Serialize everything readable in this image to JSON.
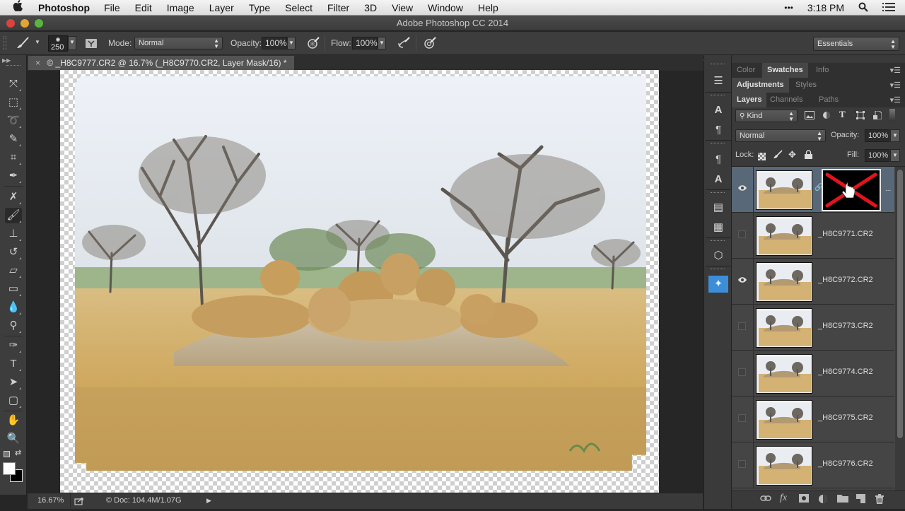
{
  "menubar": {
    "apple": "",
    "app_name": "Photoshop",
    "items": [
      "File",
      "Edit",
      "Image",
      "Layer",
      "Type",
      "Select",
      "Filter",
      "3D",
      "View",
      "Window",
      "Help"
    ],
    "overflow": "•••",
    "clock": "3:18 PM",
    "search_icon": "spotlight-search-icon",
    "list_icon": "notification-center-icon"
  },
  "window": {
    "title": "Adobe Photoshop CC 2014"
  },
  "options_bar": {
    "tool_icon": "brush-tool-icon",
    "brush_size": "250",
    "mode_label": "Mode:",
    "mode_value": "Normal",
    "opacity_label": "Opacity:",
    "opacity_value": "100%",
    "flow_label": "Flow:",
    "flow_value": "100%",
    "workspace": "Essentials"
  },
  "document": {
    "tab_title": "© _H8C9777.CR2 @ 16.7% (_H8C9770.CR2, Layer Mask/16) *",
    "close": "×"
  },
  "status_bar": {
    "zoom": "16.67%",
    "doc_info": "© Doc: 104.4M/1.07G",
    "arrow": "▶"
  },
  "tools": [
    {
      "name": "move-tool",
      "glyph": "⤧"
    },
    {
      "name": "marquee-tool",
      "glyph": "⬚"
    },
    {
      "name": "lasso-tool",
      "glyph": "➰"
    },
    {
      "name": "quick-selection-tool",
      "glyph": "✎"
    },
    {
      "name": "crop-tool",
      "glyph": "⌗"
    },
    {
      "name": "eyedropper-tool",
      "glyph": "✒"
    },
    {
      "name": "healing-brush-tool",
      "glyph": "✗"
    },
    {
      "name": "brush-tool",
      "glyph": "🖌"
    },
    {
      "name": "clone-stamp-tool",
      "glyph": "⊥"
    },
    {
      "name": "history-brush-tool",
      "glyph": "↺"
    },
    {
      "name": "eraser-tool",
      "glyph": "▱"
    },
    {
      "name": "gradient-tool",
      "glyph": "▭"
    },
    {
      "name": "blur-tool",
      "glyph": "💧"
    },
    {
      "name": "dodge-tool",
      "glyph": "⚲"
    },
    {
      "name": "pen-tool",
      "glyph": "✑"
    },
    {
      "name": "type-tool",
      "glyph": "T"
    },
    {
      "name": "path-selection-tool",
      "glyph": "➤"
    },
    {
      "name": "rectangle-tool",
      "glyph": "▢"
    },
    {
      "name": "hand-tool",
      "glyph": "✋"
    },
    {
      "name": "zoom-tool",
      "glyph": "🔍"
    }
  ],
  "panel_icons": [
    {
      "name": "tool-presets-icon",
      "glyph": "☰"
    },
    {
      "name": "character-icon",
      "glyph": "A"
    },
    {
      "name": "paragraph-icon",
      "glyph": "¶"
    },
    {
      "name": "paragraph-styles-icon",
      "glyph": "¶"
    },
    {
      "name": "character-styles-icon",
      "glyph": "A"
    },
    {
      "name": "properties-icon",
      "glyph": "▤"
    },
    {
      "name": "notes-icon",
      "glyph": "▦"
    },
    {
      "name": "3d-icon",
      "glyph": "⬡"
    },
    {
      "name": "puppet-warp-icon",
      "glyph": "✦"
    }
  ],
  "panels": {
    "group1_tabs": [
      "Color",
      "Swatches",
      "Info"
    ],
    "group1_active": "Swatches",
    "group2_tabs": [
      "Adjustments",
      "Styles"
    ],
    "group2_active": "Adjustments",
    "group3_tabs": [
      "Layers",
      "Channels",
      "Paths"
    ],
    "group3_active": "Layers",
    "filter_kind": "Kind",
    "blend_mode": "Normal",
    "opacity_label": "Opacity:",
    "opacity_value": "100%",
    "lock_label": "Lock:",
    "fill_label": "Fill:",
    "fill_value": "100%"
  },
  "layers": [
    {
      "name": "",
      "visible": true,
      "selected": true,
      "has_mask": true
    },
    {
      "name": "_H8C9771.CR2",
      "visible": false,
      "selected": false,
      "has_mask": false
    },
    {
      "name": "_H8C9772.CR2",
      "visible": true,
      "selected": false,
      "has_mask": false
    },
    {
      "name": "_H8C9773.CR2",
      "visible": false,
      "selected": false,
      "has_mask": false
    },
    {
      "name": "_H8C9774.CR2",
      "visible": false,
      "selected": false,
      "has_mask": false
    },
    {
      "name": "_H8C9775.CR2",
      "visible": false,
      "selected": false,
      "has_mask": false
    },
    {
      "name": "_H8C9776.CR2",
      "visible": false,
      "selected": false,
      "has_mask": false
    }
  ],
  "layer_footer": [
    "link-layers",
    "fx",
    "add-mask",
    "adjustment-layer",
    "new-group",
    "new-layer",
    "delete-layer"
  ],
  "colors": {
    "foreground": "#ffffff",
    "background": "#000000",
    "selected_layer": "#596878",
    "mask_x": "#e0141e"
  }
}
